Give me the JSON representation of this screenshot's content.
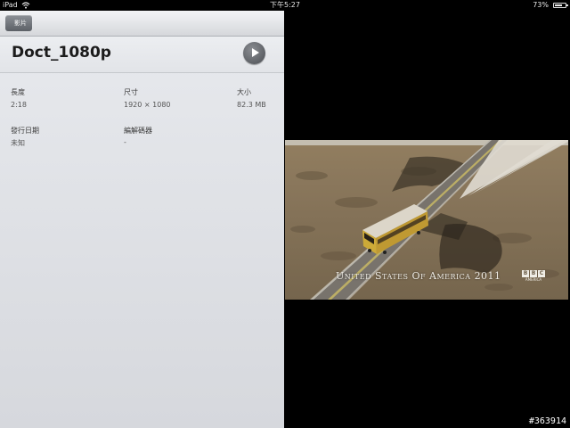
{
  "status_bar": {
    "carrier": "iPad",
    "time": "下午5:27",
    "battery_percent": "73%",
    "battery_level": 0.73
  },
  "nav": {
    "back_label": "影片"
  },
  "video": {
    "title": "Doct_1080p"
  },
  "metadata": {
    "duration_label": "長度",
    "duration_value": "2:18",
    "dimensions_label": "尺寸",
    "dimensions_value": "1920 × 1080",
    "size_label": "大小",
    "size_value": "82.3 MB",
    "release_date_label": "發行日期",
    "release_date_value": "未知",
    "codec_label": "編解碼器",
    "codec_value": "-"
  },
  "player": {
    "caption": "United States Of America 2011",
    "logo_letters": [
      "B",
      "B",
      "C"
    ],
    "logo_sub": "AMERICA"
  },
  "watermark": "#363914"
}
